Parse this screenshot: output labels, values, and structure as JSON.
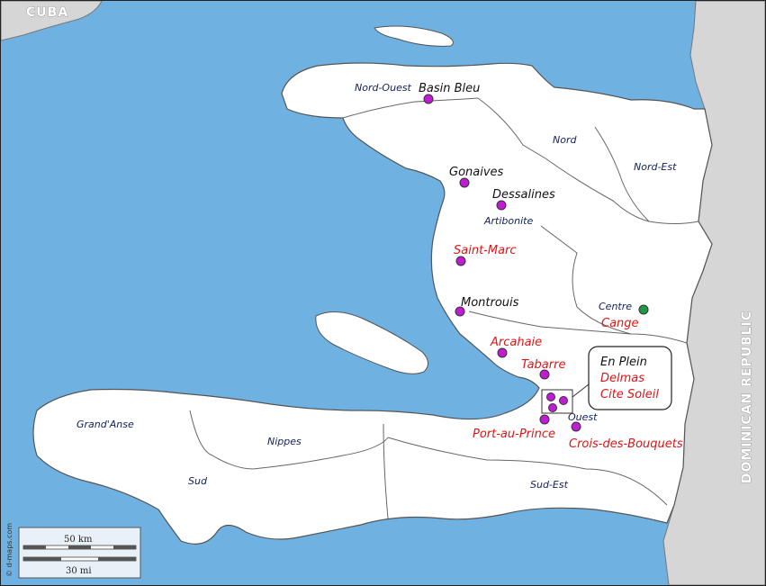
{
  "map": {
    "countries": {
      "cuba": "CUBA",
      "dominican_republic": "DOMINICAN REPUBLIC"
    },
    "departments": {
      "nord_ouest": "Nord-Ouest",
      "nord": "Nord",
      "nord_est": "Nord-Est",
      "artibonite": "Artibonite",
      "centre": "Centre",
      "ouest": "Ouest",
      "grand_anse": "Grand'Anse",
      "nippes": "Nippes",
      "sud": "Sud",
      "sud_est": "Sud-Est"
    },
    "sites": {
      "basin_bleu": "Basin Bleu",
      "gonaives": "Gonaives",
      "dessalines": "Dessalines",
      "saint_marc": "Saint-Marc",
      "montrouis": "Montrouis",
      "arcahaie": "Arcahaie",
      "tabarre": "Tabarre",
      "cange": "Cange",
      "port_au_prince": "Port-au-Prince",
      "crois_des_bouquets": "Crois-des-Bouquets"
    },
    "inset": {
      "en_plein": "En Plein",
      "delmas": "Delmas",
      "cite_soleil": "Cite Soleil"
    },
    "scale": {
      "km": "50 km",
      "mi": "30 mi"
    },
    "credit": "© d-maps.com"
  },
  "colors": {
    "sea": "#6fb2e2",
    "land": "#ffffff",
    "neighbor_land": "#d6d6d6",
    "border": "#555555",
    "marker_purple": "#c21bd6",
    "marker_green": "#1e9a44",
    "label_black": "#111111",
    "label_red": "#e01414",
    "department_label": "#13205a"
  }
}
